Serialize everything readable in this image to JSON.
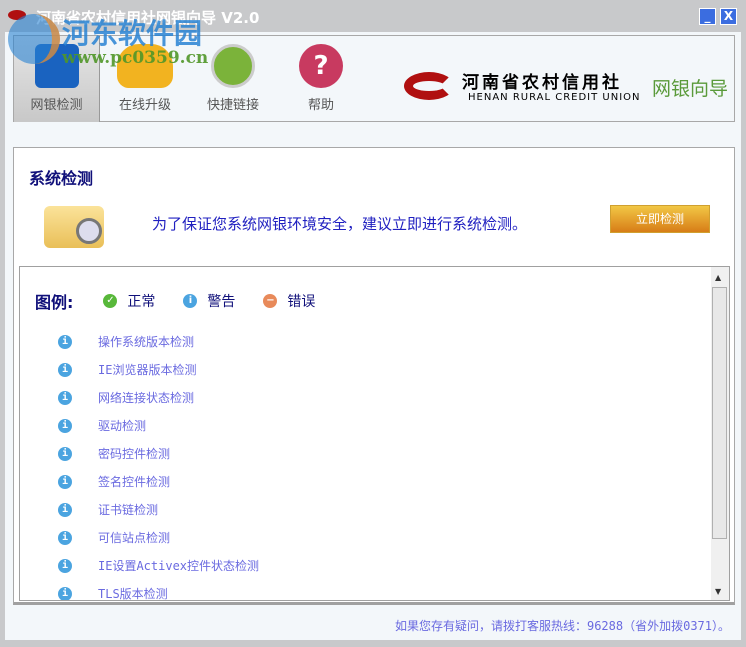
{
  "window": {
    "title": "河南省农村信用社网银向导 V2.0",
    "minimize": "_",
    "close": "X"
  },
  "watermark": {
    "name": "河东软件园",
    "url": "www.pc0359.cn"
  },
  "toolbar": [
    {
      "label": "网银检测"
    },
    {
      "label": "在线升级"
    },
    {
      "label": "快捷链接"
    },
    {
      "label": "帮助"
    }
  ],
  "brand": {
    "cn": "河南省农村信用社",
    "en": "HENAN RURAL CREDIT UNION",
    "sub": "网银向导"
  },
  "section": {
    "title": "系统检测",
    "intro": "为了保证您系统网银环境安全，建议立即进行系统检测。",
    "button": "立即检测"
  },
  "legend": {
    "title": "图例:",
    "normal": "正常",
    "warning": "警告",
    "error": "错误"
  },
  "items": [
    "操作系统版本检测",
    "IE浏览器版本检测",
    "网络连接状态检测",
    "驱动检测",
    "密码控件检测",
    "签名控件检测",
    "证书链检测",
    "可信站点检测",
    "IE设置Activex控件状态检测",
    "TLS版本检测"
  ],
  "footer": "如果您存有疑问，请拨打客服热线：96288（省外加拨0371）。"
}
